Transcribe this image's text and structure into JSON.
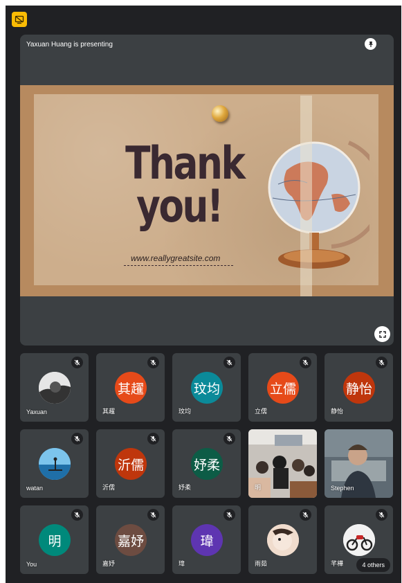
{
  "presenting_label": "Yaxuan Huang is presenting",
  "slide": {
    "title_line1": "Thank",
    "title_line2": "you!",
    "url": "www.reallygreatsite.com"
  },
  "colors": {
    "background": "#202124",
    "tile": "#3c4043",
    "present_icon": "#fbbc04"
  },
  "icons": {
    "top": "present-to-all-icon",
    "pin": "pin-icon",
    "fullscreen": "fullscreen-icon",
    "tile_status": "mic-off-icon"
  },
  "participants": [
    {
      "name": "Yaxuan",
      "avatar_text": "",
      "avatar_color": "#d9d9d9",
      "kind": "photo"
    },
    {
      "name": "其趯",
      "avatar_text": "其趯",
      "avatar_color": "#e64a19",
      "kind": "letter"
    },
    {
      "name": "玟均",
      "avatar_text": "玟均",
      "avatar_color": "#0b8a99",
      "kind": "letter"
    },
    {
      "name": "立儒",
      "avatar_text": "立儒",
      "avatar_color": "#e64a19",
      "kind": "letter"
    },
    {
      "name": "静怡",
      "avatar_text": "静怡",
      "avatar_color": "#bf360c",
      "kind": "letter"
    },
    {
      "name": "watan",
      "avatar_text": "",
      "avatar_color": "#3aa0d8",
      "kind": "photo"
    },
    {
      "name": "沂儒",
      "avatar_text": "沂儒",
      "avatar_color": "#bf360c",
      "kind": "letter"
    },
    {
      "name": "妤柔",
      "avatar_text": "妤柔",
      "avatar_color": "#0d5c46",
      "kind": "letter"
    },
    {
      "name": "明",
      "avatar_text": "",
      "avatar_color": "",
      "kind": "video"
    },
    {
      "name": "Stephen",
      "avatar_text": "",
      "avatar_color": "",
      "kind": "video"
    },
    {
      "name": "You",
      "avatar_text": "明",
      "avatar_color": "#00897b",
      "kind": "letter"
    },
    {
      "name": "嘉妤",
      "avatar_text": "嘉妤",
      "avatar_color": "#6d4c41",
      "kind": "letter"
    },
    {
      "name": "瑋",
      "avatar_text": "瑋",
      "avatar_color": "#5e35b1",
      "kind": "letter"
    },
    {
      "name": "雨茹",
      "avatar_text": "",
      "avatar_color": "#e8d2c2",
      "kind": "photo"
    },
    {
      "name": "芊樺",
      "avatar_text": "",
      "avatar_color": "#f2f2f2",
      "kind": "photo"
    }
  ],
  "others_label": "4 others"
}
